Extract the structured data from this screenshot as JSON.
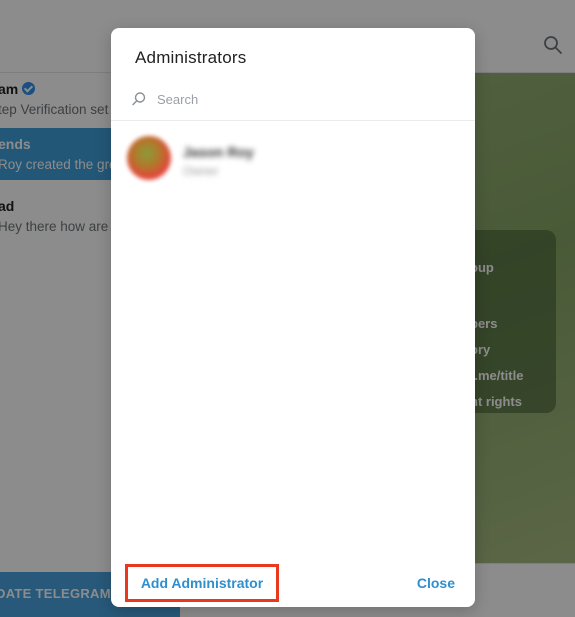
{
  "background": {
    "chats": [
      {
        "title": "am",
        "verified": true,
        "subtitle": "tep Verification set",
        "active": false
      },
      {
        "title": "ends",
        "verified": false,
        "subtitle": "Roy created the gro",
        "active": true
      },
      {
        "title": "ad",
        "verified": false,
        "subtitle": "Hey there how are",
        "active": false
      }
    ],
    "update_button": "DATE TELEGRAM",
    "info_card_lines": [
      "oup",
      "pers",
      "ory",
      "t.me/title",
      "nt rights"
    ],
    "search_icon": "search-icon"
  },
  "modal": {
    "title": "Administrators",
    "search": {
      "placeholder": "Search",
      "value": "",
      "icon": "search-icon"
    },
    "admins": [
      {
        "name": "Jason Roy",
        "role": "Owner"
      }
    ],
    "footer": {
      "add_label": "Add Administrator",
      "close_label": "Close"
    }
  },
  "colors": {
    "accent": "#2e8fcf",
    "highlight_border": "#e8391f",
    "active_chat": "#419fd9"
  }
}
